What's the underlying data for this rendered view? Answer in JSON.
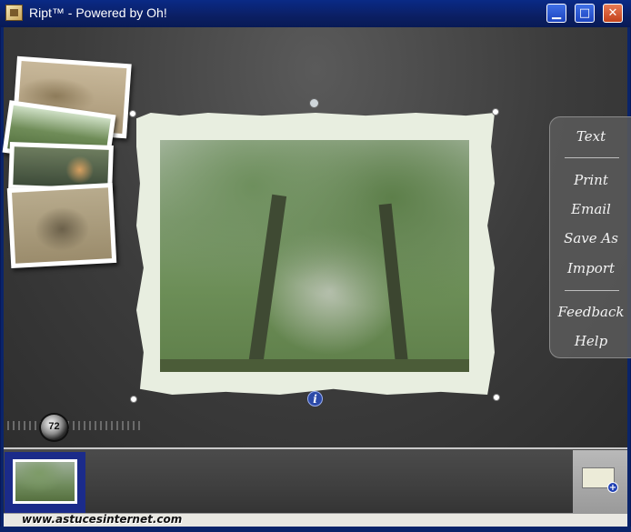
{
  "window": {
    "title": "Ript™ - Powered by Oh!",
    "minimize_icon": "minimize-icon",
    "maximize_icon": "maximize-icon",
    "close_icon": "close-icon",
    "minimize_glyph": "▁",
    "maximize_glyph": "□",
    "close_glyph": "✕"
  },
  "side_menu": {
    "items": [
      {
        "label": "Text"
      },
      {
        "label": "Print"
      },
      {
        "label": "Email"
      },
      {
        "label": "Save As"
      },
      {
        "label": "Import"
      },
      {
        "label": "Feedback"
      },
      {
        "label": "Help"
      }
    ]
  },
  "canvas": {
    "info_glyph": "i",
    "zoom_value": "72"
  },
  "filmstrip": {
    "add_glyph": "+"
  },
  "watermark": "www.astucesinternet.com"
}
